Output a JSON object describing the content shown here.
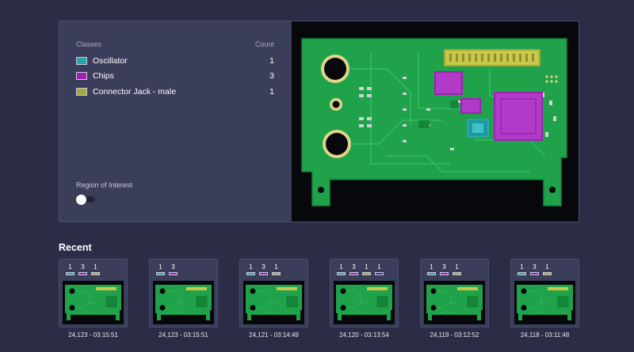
{
  "panel": {
    "classes_header": "Classes",
    "count_header": "Count",
    "classes": [
      {
        "label": "Oscillator",
        "count": "1",
        "color": "#2aa6ad"
      },
      {
        "label": "Chips",
        "count": "3",
        "color": "#a21fb4"
      },
      {
        "label": "Connector Jack - male",
        "count": "1",
        "color": "#a6a73a"
      }
    ],
    "roi_label": "Region of Interest",
    "roi_enabled": false
  },
  "recent": {
    "title": "Recent",
    "cards": [
      {
        "caption": "24,123  -  03:15:51",
        "counts": [
          {
            "n": "1",
            "color": "#2aa6ad"
          },
          {
            "n": "3",
            "color": "#a21fb4"
          },
          {
            "n": "1",
            "color": "#a6a73a"
          }
        ]
      },
      {
        "caption": "24,123  -  03:15:51",
        "counts": [
          {
            "n": "1",
            "color": "#2aa6ad"
          },
          {
            "n": "3",
            "color": "#a21fb4"
          }
        ]
      },
      {
        "caption": "24,121  -  03:14:49",
        "counts": [
          {
            "n": "1",
            "color": "#2aa6ad"
          },
          {
            "n": "3",
            "color": "#a21fb4"
          },
          {
            "n": "1",
            "color": "#a6a73a"
          }
        ]
      },
      {
        "caption": "24,120  -  03:13:54",
        "counts": [
          {
            "n": "1",
            "color": "#2aa6ad"
          },
          {
            "n": "3",
            "color": "#a21fb4"
          },
          {
            "n": "1",
            "color": "#a6a73a"
          },
          {
            "n": "1",
            "color": "#3f2fb3"
          }
        ]
      },
      {
        "caption": "24,119  -  03:12:52",
        "counts": [
          {
            "n": "1",
            "color": "#2aa6ad"
          },
          {
            "n": "3",
            "color": "#a21fb4"
          },
          {
            "n": "1",
            "color": "#a6a73a"
          }
        ]
      },
      {
        "caption": "24,118  -  03:11:48",
        "counts": [
          {
            "n": "1",
            "color": "#2aa6ad"
          },
          {
            "n": "3",
            "color": "#a21fb4"
          },
          {
            "n": "1",
            "color": "#a6a73a"
          }
        ]
      }
    ]
  },
  "colors": {
    "background": "#2a2d45",
    "panel": "#3b3e5a",
    "pcb_green": "#1fa24a",
    "oscillator": "#2aa6ad",
    "chip": "#a21fb4",
    "connector": "#a6a73a"
  }
}
